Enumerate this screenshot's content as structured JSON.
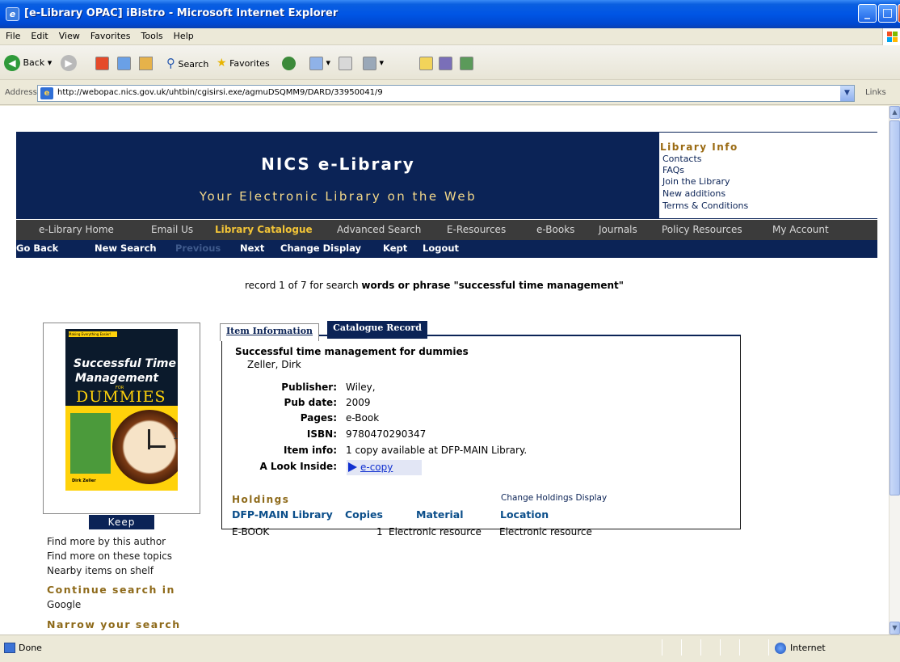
{
  "window": {
    "title": "[e-Library OPAC] iBistro - Microsoft Internet Explorer",
    "menu": [
      "File",
      "Edit",
      "View",
      "Favorites",
      "Tools",
      "Help"
    ],
    "toolbar": {
      "back": "Back",
      "search": "Search",
      "favorites": "Favorites"
    },
    "address_label": "Address",
    "url": "http://webopac.nics.gov.uk/uhtbin/cgisirsi.exe/agmuDSQMM9/DARD/33950041/9",
    "links_label": "Links",
    "status_text": "Done",
    "zone_text": "Internet"
  },
  "banner": {
    "title": "NICS e-Library",
    "tagline": "Your Electronic Library on the Web"
  },
  "library_info": {
    "title": "Library Info",
    "links": [
      "Contacts",
      "FAQs",
      "Join the Library",
      "New additions",
      "Terms & Conditions"
    ]
  },
  "nav": {
    "items": [
      "e-Library Home",
      "Email Us",
      "Library Catalogue",
      "Advanced Search",
      "E-Resources",
      "e-Books",
      "Journals",
      "Policy Resources",
      "My Account"
    ],
    "active": "Library Catalogue"
  },
  "actions": [
    "Go Back",
    "New Search",
    "Previous",
    "Next",
    "Change Display",
    "Kept",
    "Logout"
  ],
  "record_line": {
    "prefix": "record 1 of 7 for search ",
    "field": "words or phrase",
    "query": " \"successful time management\""
  },
  "cover": {
    "stripe": "Making Everything Easier!",
    "title_line1": "Successful Time",
    "title_line2": "Management",
    "for": "FOR",
    "dummies": "DUMMIES",
    "clock_number": "12",
    "author": "Dirk Zeller"
  },
  "sidebar": {
    "keep": "Keep",
    "links": [
      "Find more by this author",
      "Find more on these topics",
      "Nearby items on shelf"
    ],
    "continue_head": "Continue search in",
    "google": "Google",
    "narrow_head": "Narrow your search"
  },
  "tabs": [
    "Item Information",
    "Catalogue Record"
  ],
  "record": {
    "title": "Successful time management for dummies",
    "author": "Zeller, Dirk",
    "fields": [
      {
        "label": "Publisher:",
        "value": "Wiley,"
      },
      {
        "label": "Pub date:",
        "value": "2009"
      },
      {
        "label": "Pages:",
        "value": "e-Book"
      },
      {
        "label": "ISBN:",
        "value": "9780470290347"
      },
      {
        "label": "Item info:",
        "value": "1 copy available at DFP-MAIN Library."
      },
      {
        "label": "A Look Inside:",
        "value": ""
      }
    ],
    "ecopy": "e-copy"
  },
  "holdings": {
    "title": "Holdings",
    "change_display": "Change Holdings Display",
    "headers": [
      "DFP-MAIN Library",
      "Copies",
      "Material",
      "Location"
    ],
    "row": [
      "E-BOOK",
      "1",
      "Electronic resource",
      "Electronic resource"
    ]
  }
}
